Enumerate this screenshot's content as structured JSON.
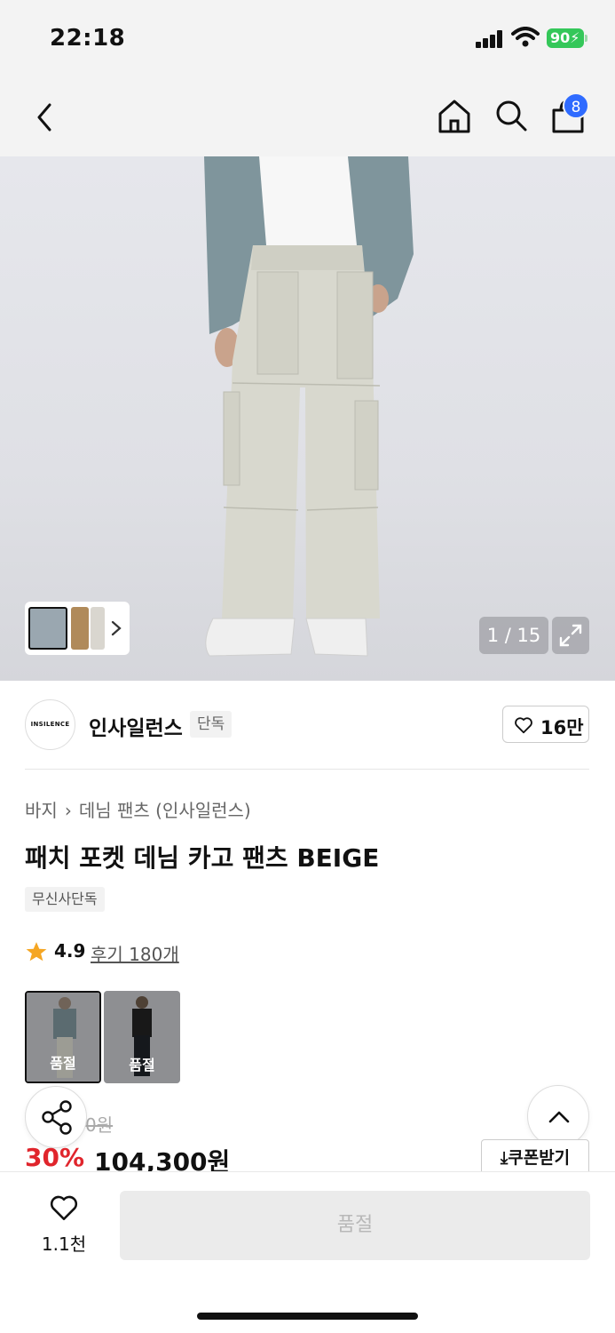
{
  "status_bar": {
    "time": "22:18",
    "battery": "90"
  },
  "nav": {
    "cart_count": "8"
  },
  "gallery": {
    "counter": "1 / 15"
  },
  "brand": {
    "logo_text": "INSILENCE",
    "name": "인사일런스",
    "tag": "단독",
    "likes": "16만"
  },
  "product": {
    "breadcrumb": [
      "바지",
      "데님 팬츠 (인사일런스)"
    ],
    "title": "패치 포켓 데님 카고 팬츠 BEIGE",
    "badge": "무신사단독",
    "rating": "4.9",
    "reviews": "후기 180개"
  },
  "options": [
    {
      "label": "품절"
    },
    {
      "label": "품절"
    }
  ],
  "price": {
    "original": "0원",
    "discount": "30%",
    "sale": "104,300원",
    "coupon": "쿠폰받기"
  },
  "bottom": {
    "wish_count": "1.1천",
    "buy_label": "품절"
  },
  "colors": {
    "accent_red": "#e0252c",
    "badge_blue": "#2f6bff",
    "battery_green": "#34c759"
  }
}
